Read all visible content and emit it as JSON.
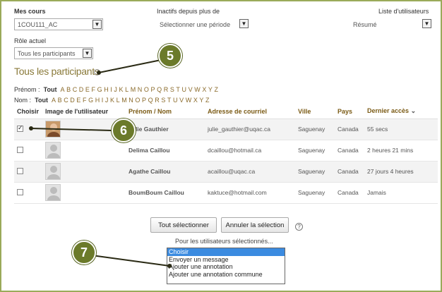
{
  "filters": {
    "courses_label": "Mes cours",
    "course_value": "1COU111_AC",
    "inactive_label": "Inactifs depuis plus de",
    "inactive_value": "Sélectionner une période",
    "user_list_label": "Liste d'utilisateurs",
    "user_list_value": "Résumé",
    "role_label": "Rôle actuel",
    "role_value": "Tous les participants"
  },
  "heading": "Tous les participants",
  "initials": {
    "firstname_label": "Prénom :",
    "lastname_label": "Nom :",
    "all_label": "Tout",
    "letters": [
      "A",
      "B",
      "C",
      "D",
      "E",
      "F",
      "G",
      "H",
      "I",
      "J",
      "K",
      "L",
      "M",
      "N",
      "O",
      "P",
      "Q",
      "R",
      "S",
      "T",
      "U",
      "V",
      "W",
      "X",
      "Y",
      "Z"
    ]
  },
  "table": {
    "columns": [
      "Choisir",
      "Image de l'utilisateur",
      "Prénom / Nom",
      "Adresse de courriel",
      "Ville",
      "Pays",
      "Dernier accès"
    ],
    "rows": [
      {
        "checked": true,
        "photo": true,
        "name": "Julie Gauthier",
        "email": "julie_gauthier@uqac.ca",
        "city": "Saguenay",
        "country": "Canada",
        "last_access": "55 secs"
      },
      {
        "checked": false,
        "photo": false,
        "name": "Delima Caillou",
        "email": "dcaillou@hotmail.ca",
        "city": "Saguenay",
        "country": "Canada",
        "last_access": "2 heures 21 mins"
      },
      {
        "checked": false,
        "photo": false,
        "name": "Agathe Caillou",
        "email": "acaillou@uqac.ca",
        "city": "Saguenay",
        "country": "Canada",
        "last_access": "27 jours 4 heures"
      },
      {
        "checked": false,
        "photo": false,
        "name": "BoumBoum Caillou",
        "email": "kaktuce@hotmail.com",
        "city": "Saguenay",
        "country": "Canada",
        "last_access": "Jamais"
      }
    ]
  },
  "actions": {
    "select_all": "Tout sélectionner",
    "deselect": "Annuler la sélection",
    "for_selected": "Pour les utilisateurs sélectionnés..."
  },
  "action_options": [
    "Choisir",
    "Envoyer un message",
    "Ajouter une annotation",
    "Ajouter une annotation commune"
  ],
  "callouts": [
    "5",
    "6",
    "7"
  ],
  "icons": {
    "dropdown": "chevron-down-icon",
    "help": "help-icon",
    "sort": "sort-desc-icon"
  },
  "colors": {
    "accent": "#7a6a12",
    "callout": "#6b7a2a",
    "frame": "#9aaa5a",
    "highlight": "#3b8be0"
  }
}
